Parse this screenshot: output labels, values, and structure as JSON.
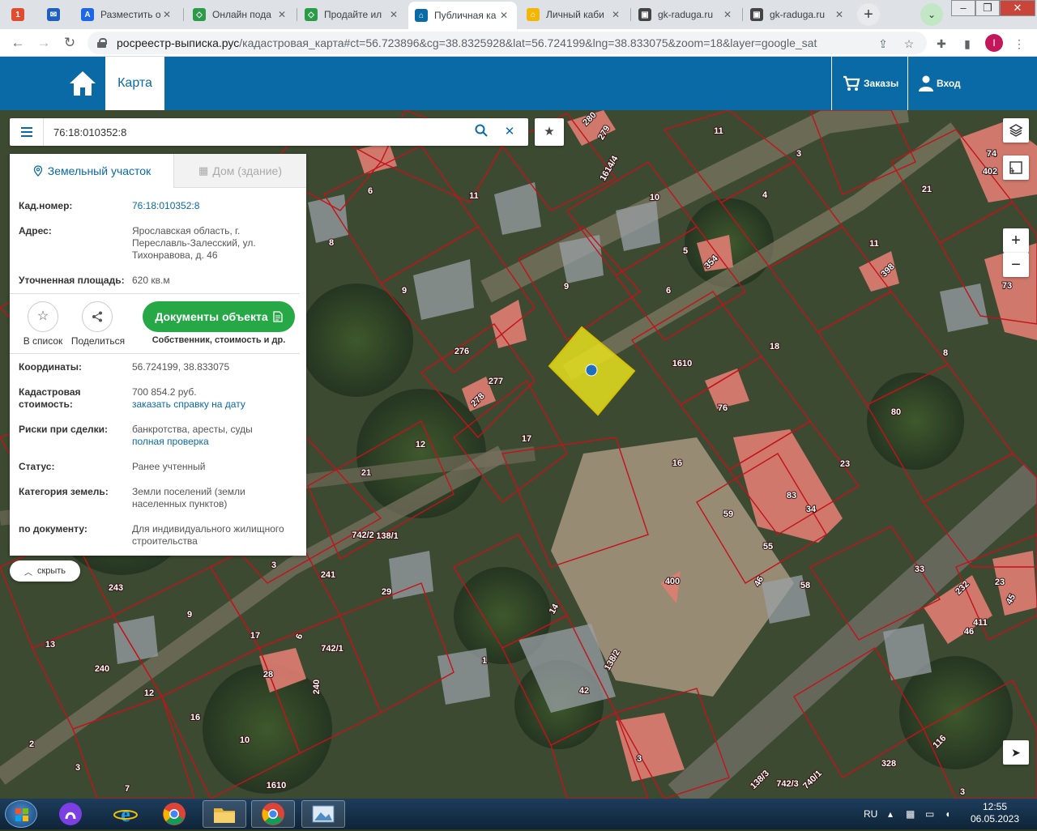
{
  "browser": {
    "tabs": [
      {
        "title": "",
        "icon": "mail-icon",
        "color": "#e34b2e"
      },
      {
        "title": "",
        "icon": "mail-icon",
        "color": "#1f5fbf"
      },
      {
        "title": "Разместить о",
        "icon": "avito-icon",
        "color": "#1e66e8"
      },
      {
        "title": "Онлайн пода",
        "icon": "domclick-icon",
        "color": "#2a9c47"
      },
      {
        "title": "Продайте ил",
        "icon": "domclick-icon",
        "color": "#2a9c47"
      },
      {
        "title": "Публичная ка",
        "icon": "home-icon",
        "color": "#0a6aa6"
      },
      {
        "title": "Личный каби",
        "icon": "home-icon",
        "color": "#f2b705"
      },
      {
        "title": "gk-raduga.ru",
        "icon": "site-icon",
        "color": "#444444"
      },
      {
        "title": "gk-raduga.ru",
        "icon": "site-icon",
        "color": "#444444"
      }
    ],
    "mail_badge": "1",
    "url_host": "росреестр-выписка.рус",
    "url_path": "/кадастровая_карта#ct=56.723896&cg=38.8325928&lat=56.724199&lng=38.833075&zoom=18&layer=google_sat",
    "profile_initial": "I"
  },
  "header": {
    "map_tab": "Карта",
    "orders": "Заказы",
    "login": "Вход"
  },
  "search": {
    "value": "76:18:010352:8"
  },
  "panel": {
    "tab_land": "Земельный участок",
    "tab_house": "Дом (здание)",
    "cad_label": "Кад.номер:",
    "cad_value": "76:18:010352:8",
    "addr_label": "Адрес:",
    "addr_value": "Ярославская область, г. Переславль-Залесский, ул. Тихонравова, д. 46",
    "area_label": "Уточненная площадь:",
    "area_value": "620 кв.м",
    "to_list": "В список",
    "share": "Поделиться",
    "docs_btn": "Документы объекта",
    "docs_sub": "Собственник, стоимость и др.",
    "coords_label": "Координаты:",
    "coords_value": "56.724199, 38.833075",
    "cost_label": "Кадастровая стоимость:",
    "cost_value": "700 854.2 руб.",
    "cost_link": "заказать справку на дату",
    "risk_label": "Риски при сделки:",
    "risk_value": "банкротства, аресты, суды",
    "risk_link": "полная проверка",
    "status_label": "Статус:",
    "status_value": "Ранее учтенный",
    "cat_label": "Категория земель:",
    "cat_value": "Земли поселений (земли населенных пунктов)",
    "doc_label": "по документу:",
    "doc_value": "Для индивидуального жилищного строительства"
  },
  "hide_label": "скрыть",
  "map_labels": [
    "280",
    "279",
    "11",
    "3",
    "74",
    "402",
    "1614/4",
    "6",
    "11",
    "10",
    "4",
    "21",
    "8",
    "5",
    "354",
    "11",
    "398",
    "73",
    "9",
    "9",
    "6",
    "276",
    "277",
    "278",
    "18",
    "1610",
    "8",
    "76",
    "80",
    "17",
    "12",
    "21",
    "16",
    "23",
    "83",
    "34",
    "59",
    "55",
    "742/2",
    "138/1",
    "3",
    "241",
    "243",
    "29",
    "400",
    "46",
    "58",
    "33",
    "232",
    "411",
    "46",
    "23",
    "45",
    "9",
    "17",
    "6",
    "742/1",
    "14",
    "13",
    "240",
    "28",
    "240",
    "12",
    "1",
    "138/2",
    "42",
    "16",
    "10",
    "2",
    "3",
    "7",
    "1610",
    "3",
    "116",
    "328",
    "138/3",
    "742/3",
    "740/1",
    "3"
  ],
  "taskbar": {
    "lang": "RU",
    "time": "12:55",
    "date": "06.05.2023"
  },
  "colors": {
    "brand": "#0a6aa6",
    "green": "#27a847",
    "parcel": "#e6e11e",
    "boundary": "#c4121a"
  }
}
